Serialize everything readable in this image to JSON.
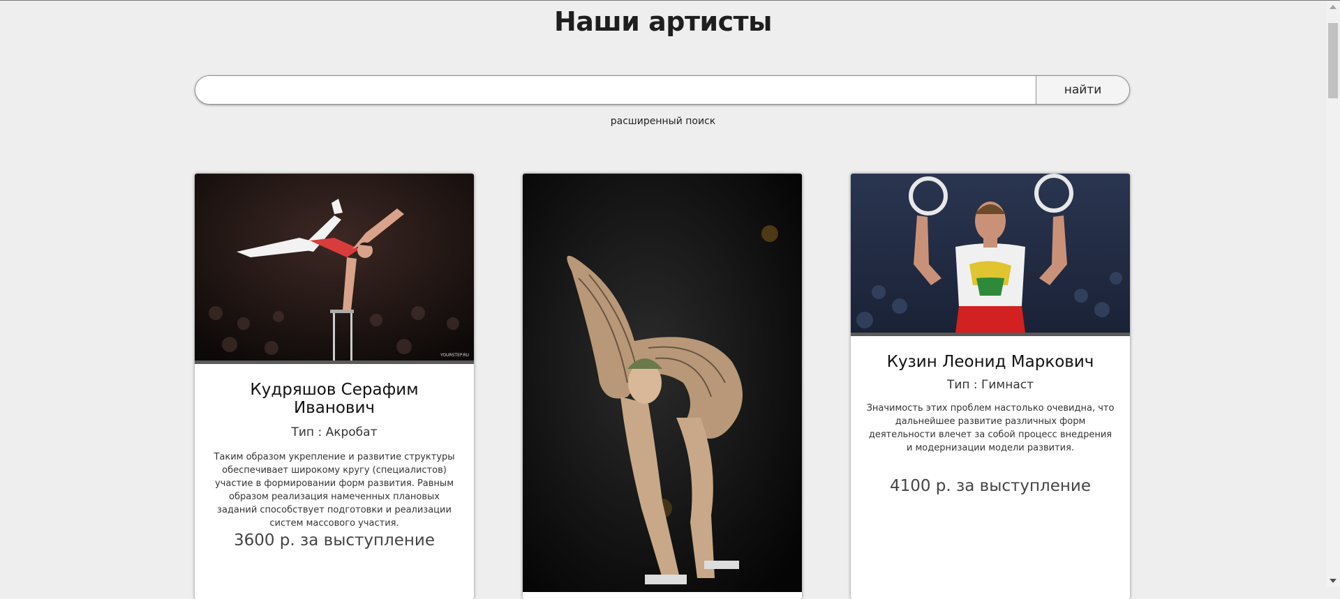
{
  "page": {
    "title": "Наши артисты"
  },
  "search": {
    "value": "",
    "placeholder": "",
    "button_label": "найти",
    "advanced_label": "расширенный поиск"
  },
  "artists": [
    {
      "name": "Кудряшов Серафим Иванович",
      "type": "Тип : Акробат",
      "description": "Таким образом укрепление и развитие структуры обеспечивает широкому кругу (специалистов) участие в формировании форм развития. Равным образом реализация намеченных плановых заданий способствует подготовки и реализации систем массового участия.",
      "price": "3600 р. за выступление",
      "photo_watermark": "YOURSTEP.RU"
    },
    {
      "name": "",
      "type": "",
      "description": "",
      "price": ""
    },
    {
      "name": "Кузин Леонид Маркович",
      "type": "Тип : Гимнаст",
      "description": "Значимость этих проблем настолько очевидна, что дальнейшее развитие различных форм деятельности влечет за собой процесс внедрения и модернизации модели развития.",
      "price": "4100 р. за выступление"
    }
  ],
  "colors": {
    "background": "#eeeeee",
    "card_background": "#ffffff",
    "photo_stripe": "#5a5a5a",
    "title_text": "#1e1e1e"
  },
  "scroll": {
    "position": 0.0
  }
}
